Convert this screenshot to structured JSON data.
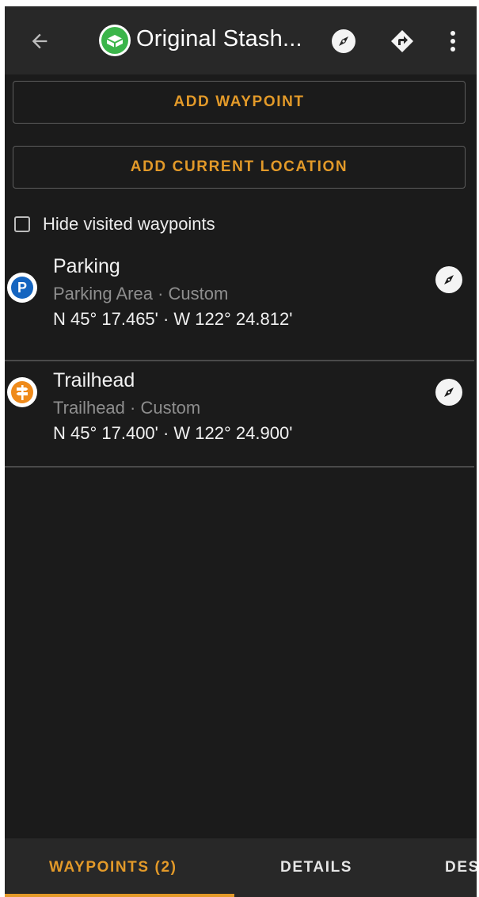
{
  "appbar": {
    "title": "Original Stash...",
    "icons": [
      "arrow-back-icon",
      "cache-type-logo-icon",
      "compass-icon",
      "directions-icon",
      "more-vert-icon"
    ]
  },
  "actions": {
    "add_waypoint": "ADD WAYPOINT",
    "add_current_location": "ADD CURRENT LOCATION"
  },
  "filter": {
    "hide_visited_label": "Hide visited waypoints",
    "checked": false
  },
  "waypoints": [
    {
      "name": "Parking",
      "meta": "Parking Area · Custom",
      "coords": "N 45° 17.465' · W 122° 24.812'",
      "icon": "parking-icon",
      "icon_letter": "P",
      "icon_color": "#1565c0"
    },
    {
      "name": "Trailhead",
      "meta": "Trailhead · Custom",
      "coords": "N 45° 17.400' · W 122° 24.900'",
      "icon": "trailhead-signpost-icon",
      "icon_color": "#ef8a1a"
    }
  ],
  "tabs": [
    {
      "label": "WAYPOINTS (2)",
      "active": true
    },
    {
      "label": "DETAILS",
      "active": false
    },
    {
      "label": "DES",
      "active": false
    }
  ],
  "colors": {
    "accent": "#e39a29",
    "background": "#1b1b1b",
    "toolbar": "#282828",
    "cache_logo_green": "#3bb54a"
  }
}
